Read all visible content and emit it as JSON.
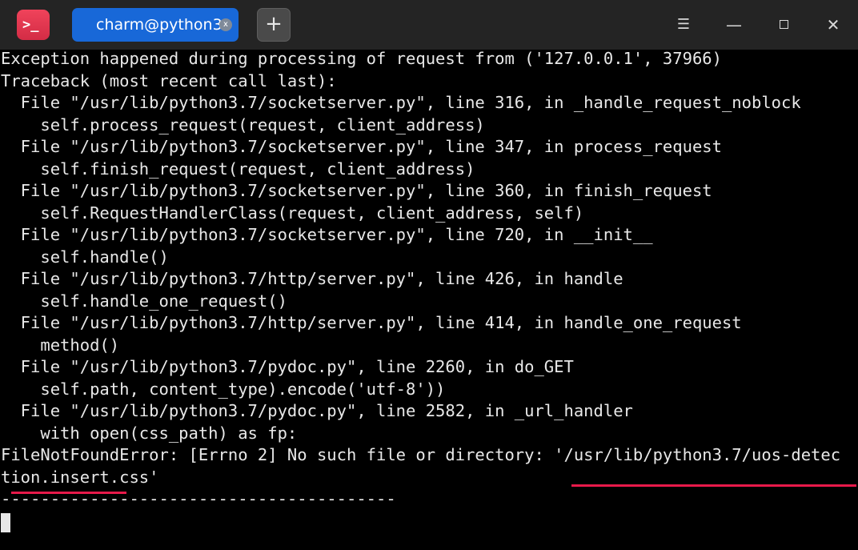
{
  "tab": {
    "title": "charm@python3",
    "close_glyph": "x"
  },
  "new_tab_glyph": "+",
  "window_controls": {
    "menu_glyph": "☰",
    "minimize_glyph": "—",
    "close_glyph": "✕"
  },
  "terminal": {
    "lines": [
      "Exception happened during processing of request from ('127.0.0.1', 37966)",
      "Traceback (most recent call last):",
      "  File \"/usr/lib/python3.7/socketserver.py\", line 316, in _handle_request_noblock",
      "    self.process_request(request, client_address)",
      "  File \"/usr/lib/python3.7/socketserver.py\", line 347, in process_request",
      "    self.finish_request(request, client_address)",
      "  File \"/usr/lib/python3.7/socketserver.py\", line 360, in finish_request",
      "    self.RequestHandlerClass(request, client_address, self)",
      "  File \"/usr/lib/python3.7/socketserver.py\", line 720, in __init__",
      "    self.handle()",
      "  File \"/usr/lib/python3.7/http/server.py\", line 426, in handle",
      "    self.handle_one_request()",
      "  File \"/usr/lib/python3.7/http/server.py\", line 414, in handle_one_request",
      "    method()",
      "  File \"/usr/lib/python3.7/pydoc.py\", line 2260, in do_GET",
      "    self.path, content_type).encode('utf-8'))",
      "  File \"/usr/lib/python3.7/pydoc.py\", line 2582, in _url_handler",
      "    with open(css_path) as fp:",
      "FileNotFoundError: [Errno 2] No such file or directory: '/usr/lib/python3.7/uos-detec",
      "tion.insert.css'",
      "----------------------------------------"
    ]
  },
  "colors": {
    "terminal_background": "#000000",
    "terminal_text": "#e8e8e8",
    "titlebar": "#242424",
    "tab_active": "#1868d8",
    "app_icon": "#e33a53",
    "annotation_underline": "#e8194a"
  }
}
